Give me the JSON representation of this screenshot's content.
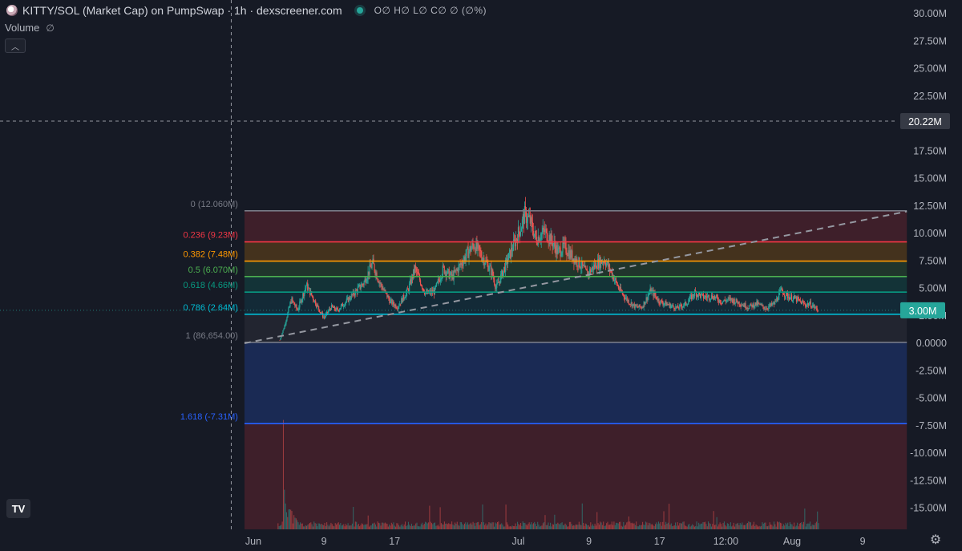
{
  "header": {
    "title": "KITTY/SOL (Market Cap) on PumpSwap · 1h · dexscreener.com",
    "ohlc": "O∅ H∅ L∅ C∅ ∅ (∅%)"
  },
  "volume_label": "Volume",
  "volume_eye": "∅",
  "collapse_glyph": "︿",
  "logo_text": "TV",
  "settings_glyph": "⚙",
  "colors": {
    "background": "#161a25",
    "up": "#26a69a",
    "down": "#ef5350",
    "axis_text": "#b2b5be",
    "price_tag": "#26a69a"
  },
  "chart_data": {
    "type": "candlestick",
    "y_ticks": [
      "30.00M",
      "27.50M",
      "25.00M",
      "22.50M",
      "20.00M",
      "17.50M",
      "15.00M",
      "12.50M",
      "10.00M",
      "7.50M",
      "5.00M",
      "2.50M",
      "0.0000",
      "-2.50M",
      "-5.00M",
      "-7.50M",
      "-10.00M",
      "-12.50M",
      "-15.00M"
    ],
    "y_tick_values": [
      30,
      27.5,
      25,
      22.5,
      20,
      17.5,
      15,
      12.5,
      10,
      7.5,
      5,
      2.5,
      0,
      -2.5,
      -5,
      -7.5,
      -10,
      -12.5,
      -15
    ],
    "y_unit": "M",
    "ylim": [
      -16.8,
      31.1
    ],
    "x_ticks": [
      {
        "label": "Jun",
        "day": 1
      },
      {
        "label": "9",
        "day": 9
      },
      {
        "label": "17",
        "day": 17
      },
      {
        "label": "Jul",
        "day": 31
      },
      {
        "label": "9",
        "day": 39
      },
      {
        "label": "17",
        "day": 47
      },
      {
        "label": "12:00",
        "day": 54.5
      },
      {
        "label": "Aug",
        "day": 62
      },
      {
        "label": "9",
        "day": 70
      }
    ],
    "x_day_range": [
      -3.5,
      70.2
    ],
    "crosshair": {
      "day": -1.5,
      "value": 20.22,
      "label": "20.22M"
    },
    "last_price": {
      "value": 3.0,
      "label": "3.00M"
    },
    "fib": {
      "start_day": 0,
      "end_day": 75,
      "levels": [
        {
          "label": "0 (12.060M)",
          "value": 12.06,
          "color": "#787b86"
        },
        {
          "label": "0.236 (9.23M)",
          "value": 9.23,
          "color": "#f23645"
        },
        {
          "label": "0.382 (7.48M)",
          "value": 7.48,
          "color": "#ff9800"
        },
        {
          "label": "0.5 (6.070M)",
          "value": 6.07,
          "color": "#4caf50"
        },
        {
          "label": "0.618 (4.66M)",
          "value": 4.66,
          "color": "#089981"
        },
        {
          "label": "0.786 (2.64M)",
          "value": 2.64,
          "color": "#00bcd4"
        },
        {
          "label": "1 (86,654.00)",
          "value": 0.0867,
          "color": "#787b86"
        },
        {
          "label": "1.618 (-7.31M)",
          "value": -7.31,
          "color": "#2962ff"
        }
      ]
    },
    "trendline": {
      "points": [
        [
          0,
          0.0
        ],
        [
          75,
          12.0
        ]
      ]
    },
    "price_path": [
      [
        4.0,
        0.3
      ],
      [
        4.5,
        1.5
      ],
      [
        5.3,
        4.0
      ],
      [
        6.0,
        3.0
      ],
      [
        7.0,
        5.3
      ],
      [
        8.3,
        3.3
      ],
      [
        9.0,
        2.3
      ],
      [
        9.8,
        3.3
      ],
      [
        10.5,
        3.0
      ],
      [
        12.0,
        4.2
      ],
      [
        13.5,
        5.5
      ],
      [
        14.5,
        7.3
      ],
      [
        15.3,
        5.5
      ],
      [
        16.5,
        3.8
      ],
      [
        17.3,
        3.3
      ],
      [
        18.5,
        4.8
      ],
      [
        19.3,
        6.8
      ],
      [
        20.5,
        4.5
      ],
      [
        21.5,
        4.7
      ],
      [
        22.5,
        6.8
      ],
      [
        23.5,
        6.0
      ],
      [
        24.5,
        7.2
      ],
      [
        25.3,
        8.3
      ],
      [
        26.0,
        9.0
      ],
      [
        27.0,
        7.8
      ],
      [
        28.0,
        6.5
      ],
      [
        28.5,
        5.0
      ],
      [
        29.5,
        7.0
      ],
      [
        30.5,
        9.0
      ],
      [
        31.3,
        10.6
      ],
      [
        31.7,
        11.7
      ],
      [
        32.3,
        11.2
      ],
      [
        33.0,
        9.5
      ],
      [
        34.0,
        10.2
      ],
      [
        34.8,
        9.3
      ],
      [
        35.5,
        8.3
      ],
      [
        36.2,
        8.8
      ],
      [
        37.0,
        8.0
      ],
      [
        38.0,
        7.2
      ],
      [
        38.8,
        6.3
      ],
      [
        39.8,
        7.2
      ],
      [
        40.8,
        7.6
      ],
      [
        41.5,
        6.5
      ],
      [
        42.5,
        4.8
      ],
      [
        43.5,
        3.8
      ],
      [
        44.3,
        3.3
      ],
      [
        45.0,
        3.3
      ],
      [
        46.0,
        4.8
      ],
      [
        47.0,
        3.8
      ],
      [
        48.0,
        3.5
      ],
      [
        49.0,
        3.2
      ],
      [
        50.0,
        3.6
      ],
      [
        51.0,
        4.6
      ],
      [
        52.0,
        4.2
      ],
      [
        53.0,
        4.3
      ],
      [
        54.0,
        3.8
      ],
      [
        55.0,
        4.0
      ],
      [
        56.0,
        3.7
      ],
      [
        57.0,
        3.3
      ],
      [
        58.0,
        3.6
      ],
      [
        59.0,
        3.2
      ],
      [
        60.0,
        3.6
      ],
      [
        60.8,
        4.8
      ],
      [
        61.5,
        4.3
      ],
      [
        62.5,
        4.0
      ],
      [
        63.5,
        3.5
      ],
      [
        64.0,
        3.6
      ],
      [
        65.0,
        3.0
      ]
    ],
    "volume": {
      "spike_day": 4.3,
      "spike_value": 0.62,
      "note_units": "fraction of volume pane height"
    }
  }
}
